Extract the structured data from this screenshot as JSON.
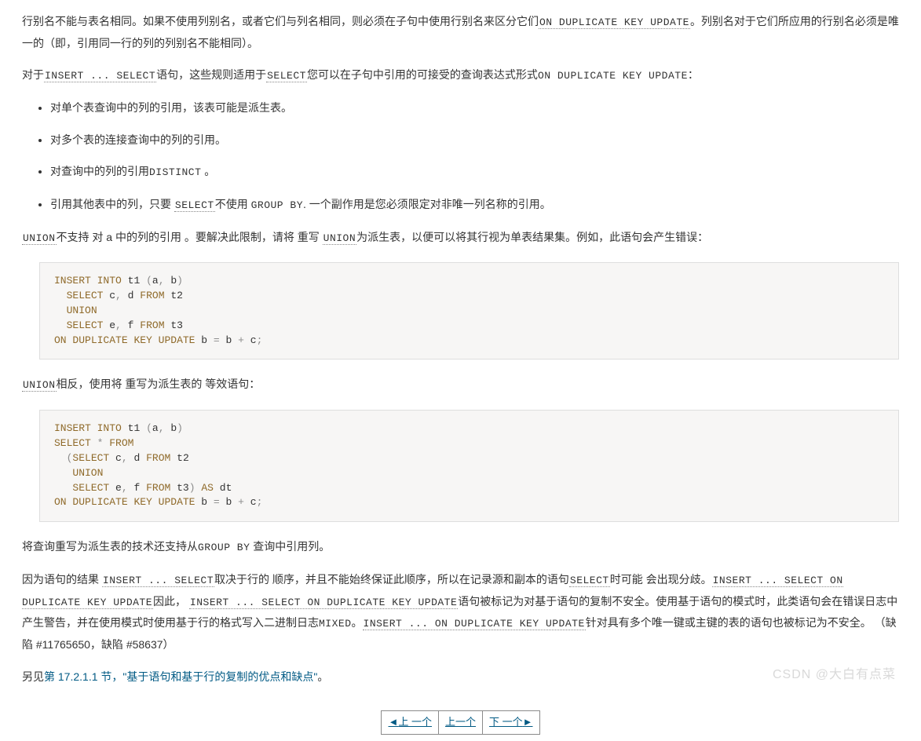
{
  "p1": {
    "a": "行别名不能与表名相同。如果不使用列别名，或者它们与列名相同，则必须在子句中使用行别名来区分它们",
    "code1": "ON DUPLICATE KEY UPDATE",
    "b": "。列别名对于它们所应用的行别名必须是唯一的（即，引用同一行的列的列别名不能相同）。"
  },
  "p2": {
    "a": "对于",
    "code1": "INSERT ... SELECT",
    "b": "语句，这些规则适用于",
    "code2": "SELECT",
    "c": "您可以在子句中引用的可接受的查询表达式形式",
    "code3": "ON DUPLICATE KEY UPDATE",
    "d": "："
  },
  "list1": {
    "i1": "对单个表查询中的列的引用，该表可能是派生表。",
    "i2": "对多个表的连接查询中的列的引用。",
    "i3a": "对查询中的列的引用",
    "i3code": "DISTINCT",
    "i3b": " 。",
    "i4a": "引用其他表中的列，只要 ",
    "i4code1": "SELECT",
    "i4b": "不使用 ",
    "i4code2": "GROUP BY",
    "i4c": ". 一个副作用是您必须限定对非唯一列名称的引用。"
  },
  "p3": {
    "code1": "UNION",
    "a": "不支持 对 a 中的列的引用 。要解决此限制，请将 重写 ",
    "code2": "UNION",
    "b": "为派生表，以便可以将其行视为单表结果集。例如，此语句会产生错误："
  },
  "code1": {
    "kw_insert": "INSERT",
    "kw_into": "INTO",
    "id_t1": "t1",
    "lp": "(",
    "id_a": "a",
    "comma": ",",
    "id_b": "b",
    "rp": ")",
    "kw_select": "SELECT",
    "id_c": "c",
    "id_d": "d",
    "kw_from": "FROM",
    "id_t2": "t2",
    "kw_union": "UNION",
    "id_e": "e",
    "id_f": "f",
    "id_t3": "t3",
    "kw_on": "ON",
    "kw_dup": "DUPLICATE",
    "kw_key": "KEY",
    "kw_upd": "UPDATE",
    "eq": "=",
    "plus": "+",
    "semi": ";"
  },
  "p4": {
    "code1": "UNION",
    "a": "相反，使用将 重写为派生表的 等效语句："
  },
  "code2": {
    "kw_insert": "INSERT",
    "kw_into": "INTO",
    "id_t1": "t1",
    "lp": "(",
    "id_a": "a",
    "comma": ",",
    "id_b": "b",
    "rp": ")",
    "kw_select": "SELECT",
    "star": "*",
    "kw_from": "FROM",
    "id_c": "c",
    "id_d": "d",
    "id_t2": "t2",
    "kw_union": "UNION",
    "id_e": "e",
    "id_f": "f",
    "id_t3": "t3",
    "kw_as": "AS",
    "id_dt": "dt",
    "kw_on": "ON",
    "kw_dup": "DUPLICATE",
    "kw_key": "KEY",
    "kw_upd": "UPDATE",
    "eq": "=",
    "plus": "+",
    "semi": ";"
  },
  "p5": {
    "a": "将查询重写为派生表的技术还支持从",
    "code1": "GROUP BY",
    "b": " 查询中引用列。"
  },
  "p6": {
    "a": "因为语句的结果 ",
    "code1": "INSERT ... SELECT",
    "b": "取决于行的 顺序，并且不能始终保证此顺序，所以在记录源和副本的语句",
    "code2": "SELECT",
    "c": "时可能 会出现分歧。",
    "code3": "INSERT ... SELECT ON DUPLICATE KEY UPDATE",
    "d": "因此， ",
    "code4": "INSERT ... SELECT ON DUPLICATE KEY UPDATE",
    "e": "语句被标记为对基于语句的复制不安全。使用基于语句的模式时，此类语句会在错误日志中产生警告，并在使用模式时使用基于行的格式写入二进制日志",
    "code5": "MIXED",
    "f": "。",
    "code6": "INSERT ... ON DUPLICATE KEY UPDATE",
    "g": "针对具有多个唯一键或主键的表的语句也被标记为不安全。  （缺陷 #11765650，缺陷 #58637）"
  },
  "p7": {
    "a": "另见",
    "link": "第 17.2.1.1 节，\"基于语句和基于行的复制的优点和缺点\"",
    "b": "。"
  },
  "pager": {
    "prev": "上 一个",
    "up": "上一个",
    "next": "下 一个"
  },
  "watermark": "CSDN @大白有点菜"
}
